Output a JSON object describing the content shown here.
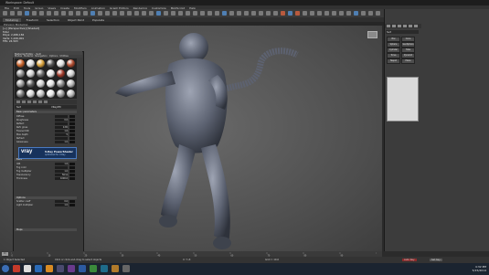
{
  "window": {
    "title": "Workspace: Default"
  },
  "menu": [
    "File",
    "Edit",
    "Tools",
    "Group",
    "Views",
    "Create",
    "Modifiers",
    "Animation",
    "Graph Editors",
    "Rendering",
    "Customize",
    "MAXScript",
    "Help"
  ],
  "ribbon": {
    "tabs": [
      "Modeling",
      "Freeform",
      "Selection",
      "Object Paint",
      "Populate"
    ],
    "active": 0,
    "sub_label": "Polygon Modeling"
  },
  "viewport": {
    "label": "[+] [Perspective] [Shaded]",
    "stats": [
      "Total",
      "Polys: 2,486,184",
      "Verts: 1,249,901",
      "FPS: 24.503"
    ]
  },
  "material_editor": {
    "title": "Material Editor - Suit",
    "menu": [
      "Modes",
      "Material",
      "Navigation",
      "Options",
      "Utilities"
    ],
    "slot_colors": [
      "#c8632b",
      "#d9d9d9",
      "#d9a23c",
      "#555",
      "#e0e0e0",
      "#b04b2f",
      "#8c8c8c",
      "#cfcfcf",
      "#6b6b6b",
      "#e6e6e6",
      "#a03a2a",
      "#d0d0d0",
      "#9a9a9a",
      "#5e5e5e",
      "#cccccc",
      "#e2e2e2",
      "#8a8a8a",
      "#b8b8b8",
      "#7a7a7a",
      "#d5d5d5",
      "#c0c0c0",
      "#e8e8e8",
      "#9c9c9c",
      "#bdbdbd"
    ],
    "material_name": "Suit",
    "material_type": "VRayMtl",
    "rollouts": [
      "Basic parameters",
      "BRDF",
      "Options",
      "Maps"
    ],
    "params": [
      {
        "label": "Diffuse",
        "value": ""
      },
      {
        "label": "Roughness",
        "value": "0.0"
      },
      {
        "label": "Reflect",
        "value": ""
      },
      {
        "label": "Refl. gloss",
        "value": "0.65"
      },
      {
        "label": "Fresnel IOR",
        "value": "1.6"
      },
      {
        "label": "Max depth",
        "value": "5"
      },
      {
        "label": "Refract",
        "value": ""
      },
      {
        "label": "Glossiness",
        "value": "1.0"
      },
      {
        "label": "IOR",
        "value": "1.6"
      },
      {
        "label": "Fog color",
        "value": ""
      },
      {
        "label": "Fog multiplier",
        "value": "1.0"
      },
      {
        "label": "Translucency",
        "value": "None"
      },
      {
        "label": "Thickness",
        "value": "1000.0"
      },
      {
        "label": "Scatter coeff",
        "value": "0.0"
      },
      {
        "label": "Light multiplier",
        "value": "1.0"
      }
    ],
    "vray": {
      "logo": "vray",
      "line1": "V-Ray PowerShader",
      "line2": "optimized for V-Ray"
    }
  },
  "command_panel": {
    "field": "Suit",
    "buttons": [
      "Box",
      "Cone",
      "Sphere",
      "GeoSphere",
      "Cylinder",
      "Tube",
      "Torus",
      "Pyramid",
      "Teapot",
      "Plane"
    ]
  },
  "timeline": {
    "frame": "0 / 100",
    "ticks": [
      "0",
      "10",
      "20",
      "30",
      "40",
      "50",
      "60",
      "70",
      "80",
      "90",
      "100"
    ]
  },
  "status": {
    "selection": "1 Object Selected",
    "prompt": "Click or click-and-drag to select objects",
    "coords": "X:  Y:  Z:",
    "grid": "Grid = 10.0",
    "autokey": "Auto Key",
    "setkey": "Set Key"
  },
  "taskbar": {
    "time": "4:32 PM",
    "date": "5/15/2014"
  }
}
